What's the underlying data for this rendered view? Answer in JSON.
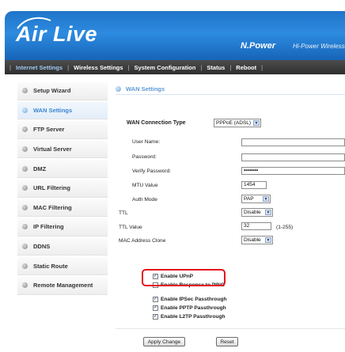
{
  "brand": {
    "logo": "Air Live",
    "product": "N.Power",
    "tagline": "Hi-Power Wireless"
  },
  "nav": [
    "Internet Settings",
    "Wireless Settings",
    "System Configuration",
    "Status",
    "Reboot"
  ],
  "sidebar": {
    "items": [
      {
        "label": "Setup Wizard"
      },
      {
        "label": "WAN Settings"
      },
      {
        "label": "FTP Server"
      },
      {
        "label": "Virtual Server"
      },
      {
        "label": "DMZ"
      },
      {
        "label": "URL Filtering"
      },
      {
        "label": "MAC Filtering"
      },
      {
        "label": "IP Filtering"
      },
      {
        "label": "DDNS"
      },
      {
        "label": "Static Route"
      },
      {
        "label": "Remote Management"
      }
    ]
  },
  "page": {
    "title": "WAN Settings"
  },
  "form": {
    "connection_type_label": "WAN Connection Type",
    "connection_type_value": "PPPoE (ADSL)",
    "username_label": "User Name:",
    "username_value": "",
    "password_label": "Password:",
    "password_value": "",
    "verify_password_label": "Verify Password:",
    "verify_password_value": "••••••••",
    "mtu_label": "MTU Value",
    "mtu_value": "1454",
    "auth_mode_label": "Auth Mode",
    "auth_mode_value": "PAP",
    "ttl_label": "TTL",
    "ttl_value": "Disable",
    "ttl_value_label": "TTL Value",
    "ttl_value_value": "32",
    "ttl_range": "(1-255)",
    "mac_clone_label": "MAC Address Clone",
    "mac_clone_value": "Disable"
  },
  "checkboxes": {
    "upnp": "Enable UPnP",
    "ping": "Enable Response to PING",
    "ipsec": "Enable IPSec Passthrough",
    "pptp": "Enable PPTP Passthrough",
    "l2tp": "Enable L2TP Passthrough"
  },
  "buttons": {
    "apply": "Apply Change",
    "reset": "Reset"
  },
  "colors": {
    "header_blue": "#2d8be0",
    "nav_dark": "#3a3a3a",
    "accent": "#3a86d1",
    "highlight": "#e4141b"
  }
}
